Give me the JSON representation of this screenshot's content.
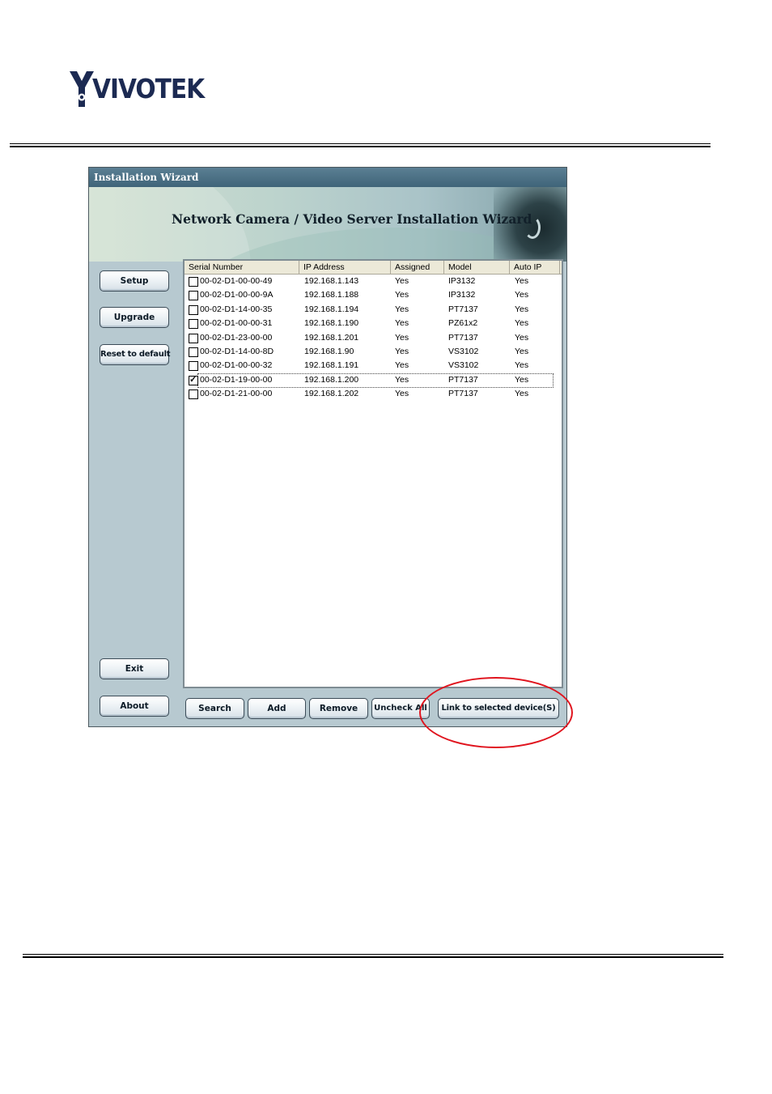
{
  "logo": {
    "brand_text": "VIVOTEK",
    "colors": {
      "mark": "#1c2a52"
    }
  },
  "window": {
    "title": "Installation Wizard",
    "banner_title": "Network Camera / Video Server Installation Wizard"
  },
  "sidebar": {
    "buttons": [
      {
        "label": "Setup"
      },
      {
        "label": "Upgrade"
      },
      {
        "label": "Reset to default"
      },
      {
        "label": "Exit"
      },
      {
        "label": "About"
      }
    ]
  },
  "device_list": {
    "columns": [
      "Serial Number",
      "IP Address",
      "Assigned",
      "Model",
      "Auto IP"
    ],
    "rows": [
      {
        "checked": false,
        "serial": "00-02-D1-00-00-49",
        "ip": "192.168.1.143",
        "assigned": "Yes",
        "model": "IP3132",
        "auto_ip": "Yes"
      },
      {
        "checked": false,
        "serial": "00-02-D1-00-00-9A",
        "ip": "192.168.1.188",
        "assigned": "Yes",
        "model": "IP3132",
        "auto_ip": "Yes"
      },
      {
        "checked": false,
        "serial": "00-02-D1-14-00-35",
        "ip": "192.168.1.194",
        "assigned": "Yes",
        "model": "PT7137",
        "auto_ip": "Yes"
      },
      {
        "checked": false,
        "serial": "00-02-D1-00-00-31",
        "ip": "192.168.1.190",
        "assigned": "Yes",
        "model": "PZ61x2",
        "auto_ip": "Yes"
      },
      {
        "checked": false,
        "serial": "00-02-D1-23-00-00",
        "ip": "192.168.1.201",
        "assigned": "Yes",
        "model": "PT7137",
        "auto_ip": "Yes"
      },
      {
        "checked": false,
        "serial": "00-02-D1-14-00-8D",
        "ip": "192.168.1.90",
        "assigned": "Yes",
        "model": "VS3102",
        "auto_ip": "Yes"
      },
      {
        "checked": false,
        "serial": "00-02-D1-00-00-32",
        "ip": "192.168.1.191",
        "assigned": "Yes",
        "model": "VS3102",
        "auto_ip": "Yes"
      },
      {
        "checked": true,
        "serial": "00-02-D1-19-00-00",
        "ip": "192.168.1.200",
        "assigned": "Yes",
        "model": "PT7137",
        "auto_ip": "Yes",
        "selected": true
      },
      {
        "checked": false,
        "serial": "00-02-D1-21-00-00",
        "ip": "192.168.1.202",
        "assigned": "Yes",
        "model": "PT7137",
        "auto_ip": "Yes"
      }
    ]
  },
  "bottom_buttons": {
    "search": "Search",
    "add": "Add",
    "remove": "Remove",
    "uncheck_all": "Uncheck All",
    "link": "Link to selected device(S)"
  },
  "colors": {
    "highlight": "#e0141e",
    "window_bg": "#b7c9d0",
    "titlebar": "#3f6479"
  }
}
